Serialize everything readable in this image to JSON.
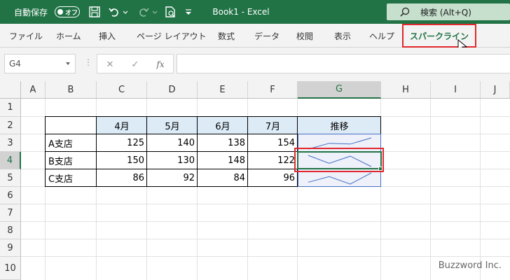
{
  "titlebar": {
    "autosave_label": "自動保存",
    "autosave_state": "オフ",
    "doc_title": "Book1  -  Excel",
    "search_label": "検索 (Alt+Q)"
  },
  "ribbon": {
    "tabs": [
      "ファイル",
      "ホーム",
      "挿入",
      "ページ レイアウト",
      "数式",
      "データ",
      "校閲",
      "表示",
      "ヘルプ"
    ],
    "active_tab": "スパークライン"
  },
  "formula_bar": {
    "name_box": "G4",
    "fx_label": "fx",
    "formula": ""
  },
  "sheet": {
    "columns": [
      "A",
      "B",
      "C",
      "D",
      "E",
      "F",
      "G",
      "H",
      "I",
      "J"
    ],
    "rows": [
      "1",
      "2",
      "3",
      "4",
      "5",
      "6",
      "7",
      "8",
      "9",
      "10"
    ],
    "selected_cell": "G4",
    "table": {
      "headers": [
        "4月",
        "5月",
        "6月",
        "7月"
      ],
      "trend_header": "推移",
      "rows": [
        {
          "label": "A支店",
          "values": [
            125,
            140,
            138,
            154
          ]
        },
        {
          "label": "B支店",
          "values": [
            150,
            130,
            148,
            122
          ]
        },
        {
          "label": "C支店",
          "values": [
            86,
            92,
            84,
            96
          ]
        }
      ]
    }
  },
  "colors": {
    "excel_green": "#217346",
    "highlight_red": "#e0282e",
    "sparkline": "#4472c4",
    "header_fill": "#ddebf7"
  },
  "watermark": "Buzzword Inc."
}
